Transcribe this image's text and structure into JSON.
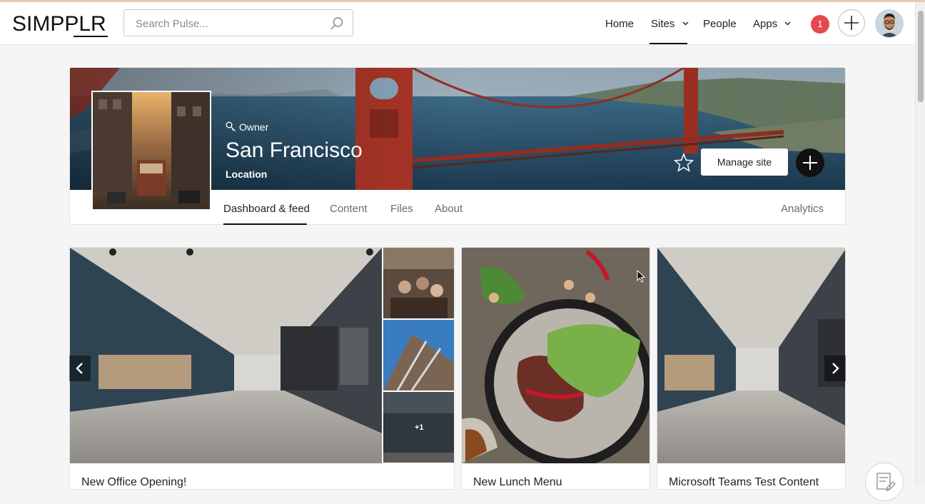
{
  "app": {
    "logo": "SIMPPLR"
  },
  "search": {
    "placeholder": "Search Pulse..."
  },
  "nav": {
    "items": [
      {
        "label": "Home"
      },
      {
        "label": "Sites"
      },
      {
        "label": "People"
      },
      {
        "label": "Apps"
      }
    ],
    "active": "Sites",
    "notification_count": "1"
  },
  "site": {
    "role": "Owner",
    "title": "San Francisco",
    "subtitle": "Location",
    "manage_label": "Manage site",
    "tabs": [
      {
        "label": "Dashboard & feed"
      },
      {
        "label": "Content"
      },
      {
        "label": "Files"
      },
      {
        "label": "About"
      }
    ],
    "analytics_label": "Analytics",
    "active_tab": "Dashboard & feed"
  },
  "feed": {
    "cards": [
      {
        "title": "New Office Opening!",
        "extra_images": "+1"
      },
      {
        "title": "New Lunch Menu"
      },
      {
        "title": "Microsoft Teams Test Content"
      }
    ]
  },
  "colors": {
    "accent": "#111111",
    "notification": "#e5484d"
  }
}
